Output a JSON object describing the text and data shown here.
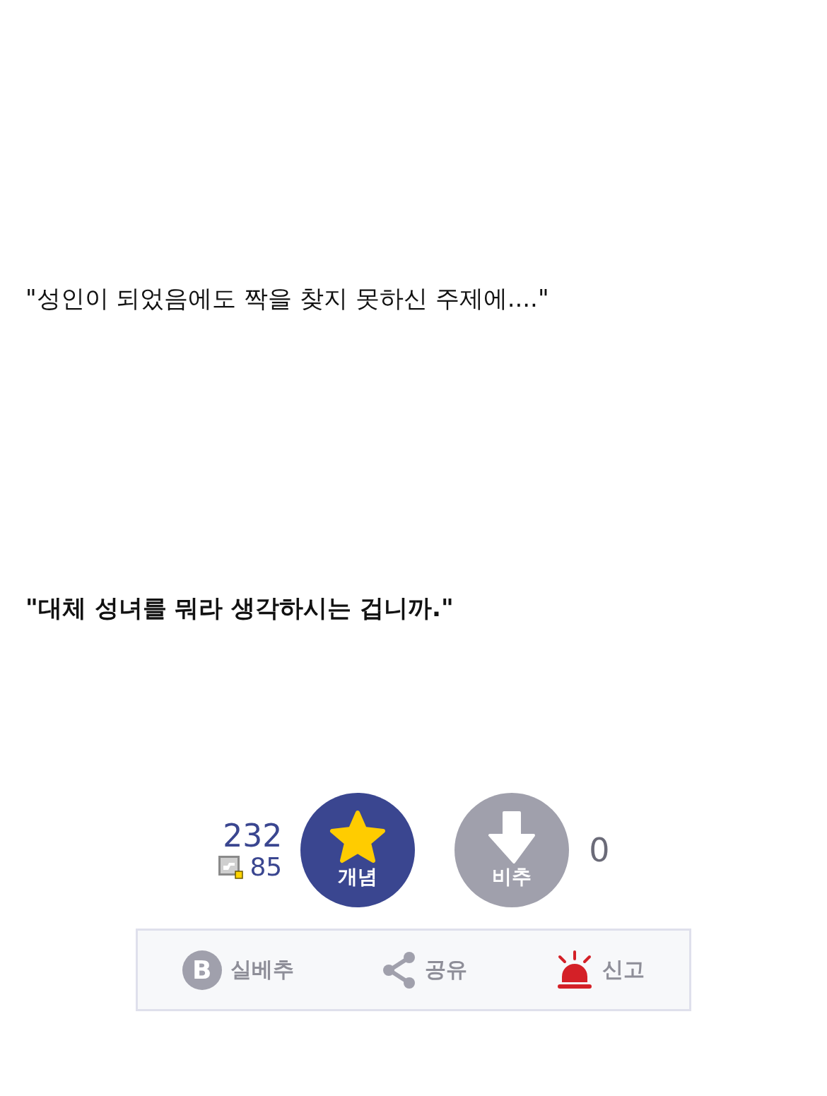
{
  "paragraphs": [
    {
      "text": "\"성인이 되었음에도 짝을 찾지 못하신 주제에....\"",
      "bold": false
    },
    {
      "text": "\"대체 성녀를 뭐라 생각하시는 겁니까.\"",
      "bold": true
    }
  ],
  "votes": {
    "up_count": "232",
    "fixed_count": "85",
    "up_label": "개념",
    "down_label": "비추",
    "down_count": "0"
  },
  "actions": [
    {
      "kind": "best",
      "letter": "B",
      "label": "실베추"
    },
    {
      "kind": "share",
      "label": "공유"
    },
    {
      "kind": "report",
      "label": "신고"
    }
  ]
}
